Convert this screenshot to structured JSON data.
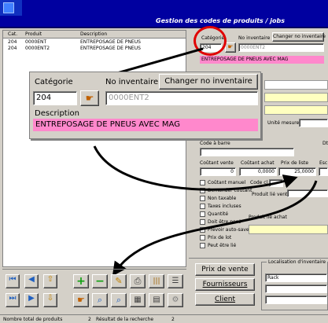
{
  "window": {
    "title": "Gestion des codes de produits / jobs"
  },
  "list": {
    "headers": [
      "Cat.",
      "Produit",
      "Description"
    ],
    "rows": [
      [
        "204",
        "0000ENT",
        "ENTREPOSAGE DE PNEUS"
      ],
      [
        "204",
        "0000ENT2",
        "ENTREPOSAGE DE PNEUS"
      ]
    ]
  },
  "form_small": {
    "categorie_label": "Catégorie",
    "no_inventaire_label": "No inventaire",
    "changer_button": "Changer no inventaire",
    "categorie_value": "204",
    "product_code": "0000ENT2",
    "description_value": "ENTREPOSAGE DE PNEUS AVEC MAG"
  },
  "zoom": {
    "categorie_label": "Catégorie",
    "no_inventaire_label": "No inventaire",
    "changer_button": "Changer no inventaire",
    "categorie_value": "204",
    "product_code": "0000ENT2",
    "description_label": "Description",
    "description_value": "ENTREPOSAGE DE PNEUS AVEC MAG"
  },
  "details": {
    "unite_mesure": "Unité mesure",
    "code_barre": "Code à barre",
    "dt_label": "Dt",
    "cout_vente_label": "Coûtant vente",
    "cout_achat_label": "Coûtant achat",
    "prix_liste_label": "Prix de liste",
    "esc_label": "Esc",
    "cout_vente_value": "0",
    "cout_achat_value": "0,0000",
    "prix_liste_value": "25,0000",
    "code_cl_label": "Code cl",
    "produit_lie_vente": "Produit lié vente",
    "produit_lie_achat": "Produit lié achat",
    "checks": [
      "Coûtant manuel",
      "Demander coûtant",
      "Non taxable",
      "Taxes incluses",
      "Quantité",
      "Doit être pesé",
      "Prévoir auto-save",
      "Prix de lot",
      "Peut être lié"
    ]
  },
  "bottom_buttons": {
    "prix_vente": "Prix de vente",
    "fournisseurs": "Fournisseurs",
    "client": "Client",
    "localisation_label": "Localisation d'inventaire",
    "localisation_value": "Rack"
  },
  "status": {
    "total_label": "Nombre total de produits",
    "total_value": "2",
    "result_label": "Résultat de la recherche",
    "result_value": "2"
  },
  "colors": {
    "title_bar": "#0000a0",
    "highlight": "#ff88cc",
    "yellow": "#ffffc0",
    "circle": "#e00000"
  }
}
